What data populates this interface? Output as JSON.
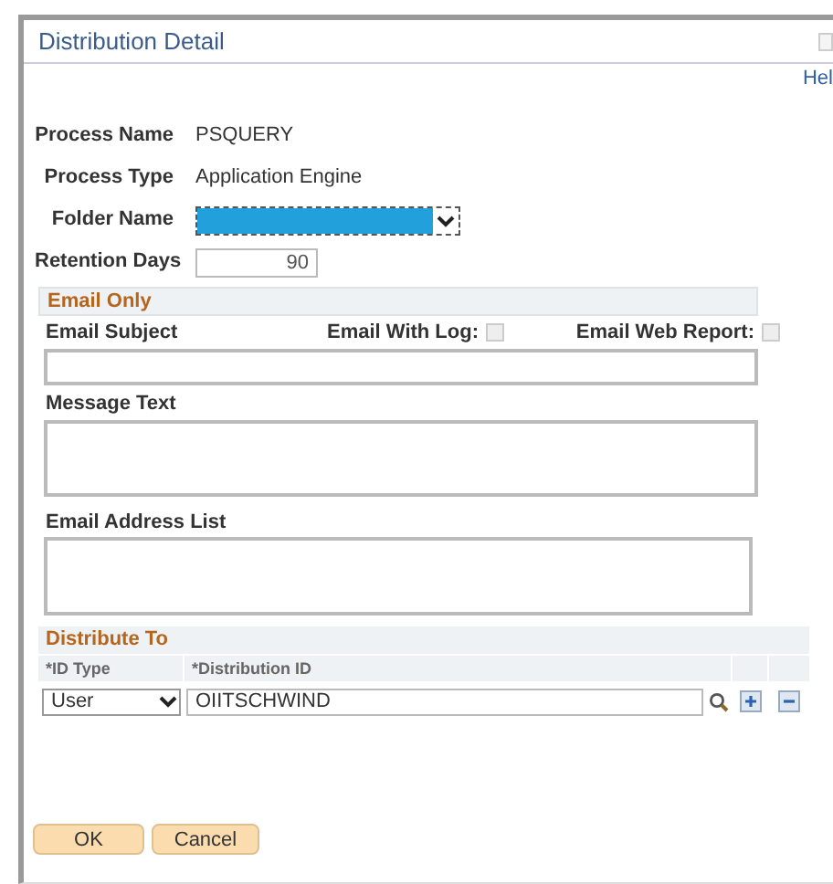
{
  "window": {
    "title": "Distribution Detail"
  },
  "help_link": "Hel",
  "fields": [
    {
      "kind": "text",
      "label": "Process Name",
      "value": "PSQUERY"
    },
    {
      "kind": "text",
      "label": "Process Type",
      "value": "Application Engine"
    },
    {
      "kind": "select",
      "label": "Folder Name",
      "focused": true
    },
    {
      "kind": "input",
      "label": "Retention Days",
      "value": "90"
    }
  ],
  "email_section": {
    "title": "Email Only",
    "subject_label": "Email Subject",
    "checkboxes": [
      {
        "label": "Email With Log:",
        "checked": false
      },
      {
        "label": "Email Web Report:",
        "checked": false
      }
    ],
    "message_label": "Message Text",
    "address_label": "Email Address List"
  },
  "distribute_section": {
    "title": "Distribute To",
    "columns": [
      "*ID Type",
      "*Distribution ID"
    ],
    "rows": [
      {
        "id_type": "User",
        "distribution_id": "OIITSCHWIND"
      }
    ]
  },
  "buttons": [
    "OK",
    "Cancel"
  ]
}
